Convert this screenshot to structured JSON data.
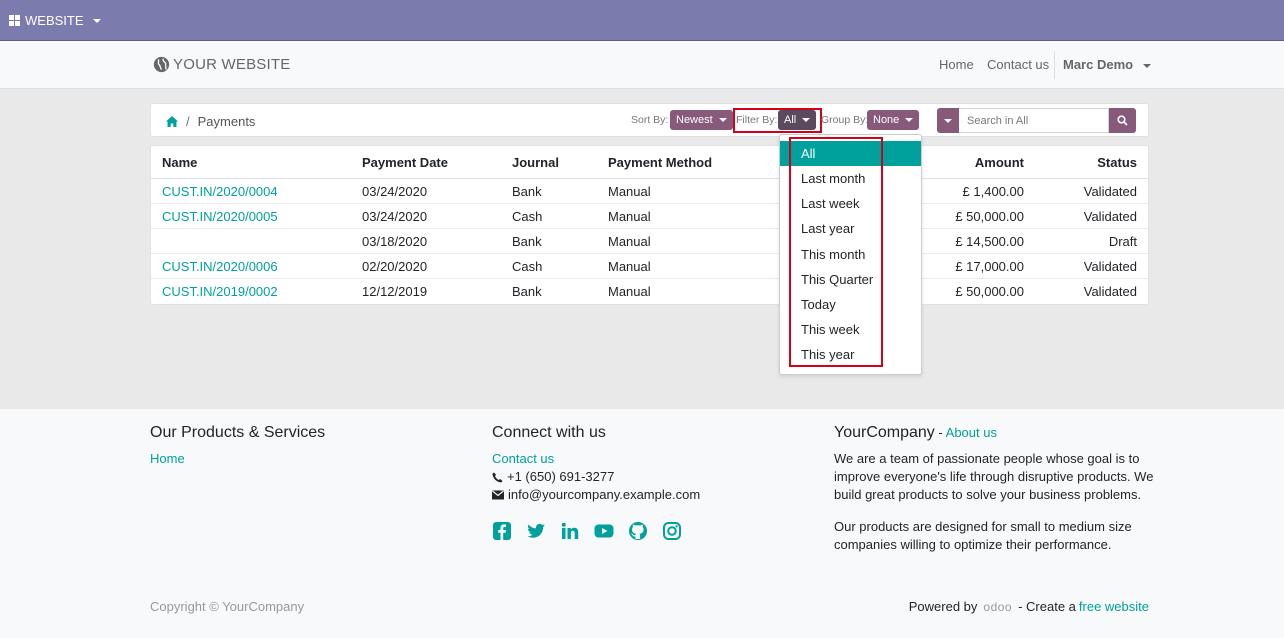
{
  "topbar": {
    "website_label": "WEBSITE"
  },
  "header": {
    "logo_text": "YOUR WEBSITE",
    "nav_home": "Home",
    "nav_contact": "Contact us",
    "user_name": "Marc Demo"
  },
  "breadcrumb": {
    "current": "Payments"
  },
  "controls": {
    "sort_label": "Sort By:",
    "sort_value": "Newest",
    "filter_label": "Filter By:",
    "filter_value": "All",
    "group_label": "Group By:",
    "group_value": "None",
    "search_placeholder": "Search in All"
  },
  "table": {
    "headers": [
      "Name",
      "Payment Date",
      "Journal",
      "Payment Method",
      "Amount",
      "Status"
    ],
    "rows": [
      {
        "name": "CUST.IN/2020/0004",
        "date": "03/24/2020",
        "journal": "Bank",
        "method": "Manual",
        "amount": "£ 1,400.00",
        "status": "Validated"
      },
      {
        "name": "CUST.IN/2020/0005",
        "date": "03/24/2020",
        "journal": "Cash",
        "method": "Manual",
        "amount": "£ 50,000.00",
        "status": "Validated"
      },
      {
        "name": "",
        "date": "03/18/2020",
        "journal": "Bank",
        "method": "Manual",
        "amount": "£ 14,500.00",
        "status": "Draft"
      },
      {
        "name": "CUST.IN/2020/0006",
        "date": "02/20/2020",
        "journal": "Cash",
        "method": "Manual",
        "amount": "£ 17,000.00",
        "status": "Validated"
      },
      {
        "name": "CUST.IN/2019/0002",
        "date": "12/12/2019",
        "journal": "Bank",
        "method": "Manual",
        "amount": "£ 50,000.00",
        "status": "Validated"
      }
    ]
  },
  "filter_dropdown": {
    "items": [
      "All",
      "Last month",
      "Last week",
      "Last year",
      "This month",
      "This Quarter",
      "Today",
      "This week",
      "This year"
    ],
    "active": "All"
  },
  "footer": {
    "products_title": "Our Products & Services",
    "products_home": "Home",
    "connect_title": "Connect with us",
    "connect_contact": "Contact us",
    "phone": "+1 (650) 691-3277",
    "email": "info@yourcompany.example.com",
    "company_title": "YourCompany",
    "company_dash": " - ",
    "about_link": "About us",
    "about_text_1": "We are a team of passionate people whose goal is to improve everyone's life through disruptive products. We build great products to solve your business problems.",
    "about_text_2": "Our products are designed for small to medium size companies willing to optimize their performance.",
    "copyright": "Copyright © YourCompany",
    "powered_by": "Powered by",
    "odoo": "odoo",
    "create_a": "- Create a",
    "free_website": "free website"
  },
  "colors": {
    "topbar": "#7c7bad",
    "accent": "#00a09d",
    "button": "#875a7b",
    "highlight": "#d0021b"
  },
  "icons": [
    "grid-icon",
    "globe-icon",
    "home-icon",
    "caret-icon",
    "search-icon",
    "phone-icon",
    "envelope-icon",
    "facebook-icon",
    "twitter-icon",
    "linkedin-icon",
    "youtube-icon",
    "github-icon",
    "instagram-icon"
  ]
}
